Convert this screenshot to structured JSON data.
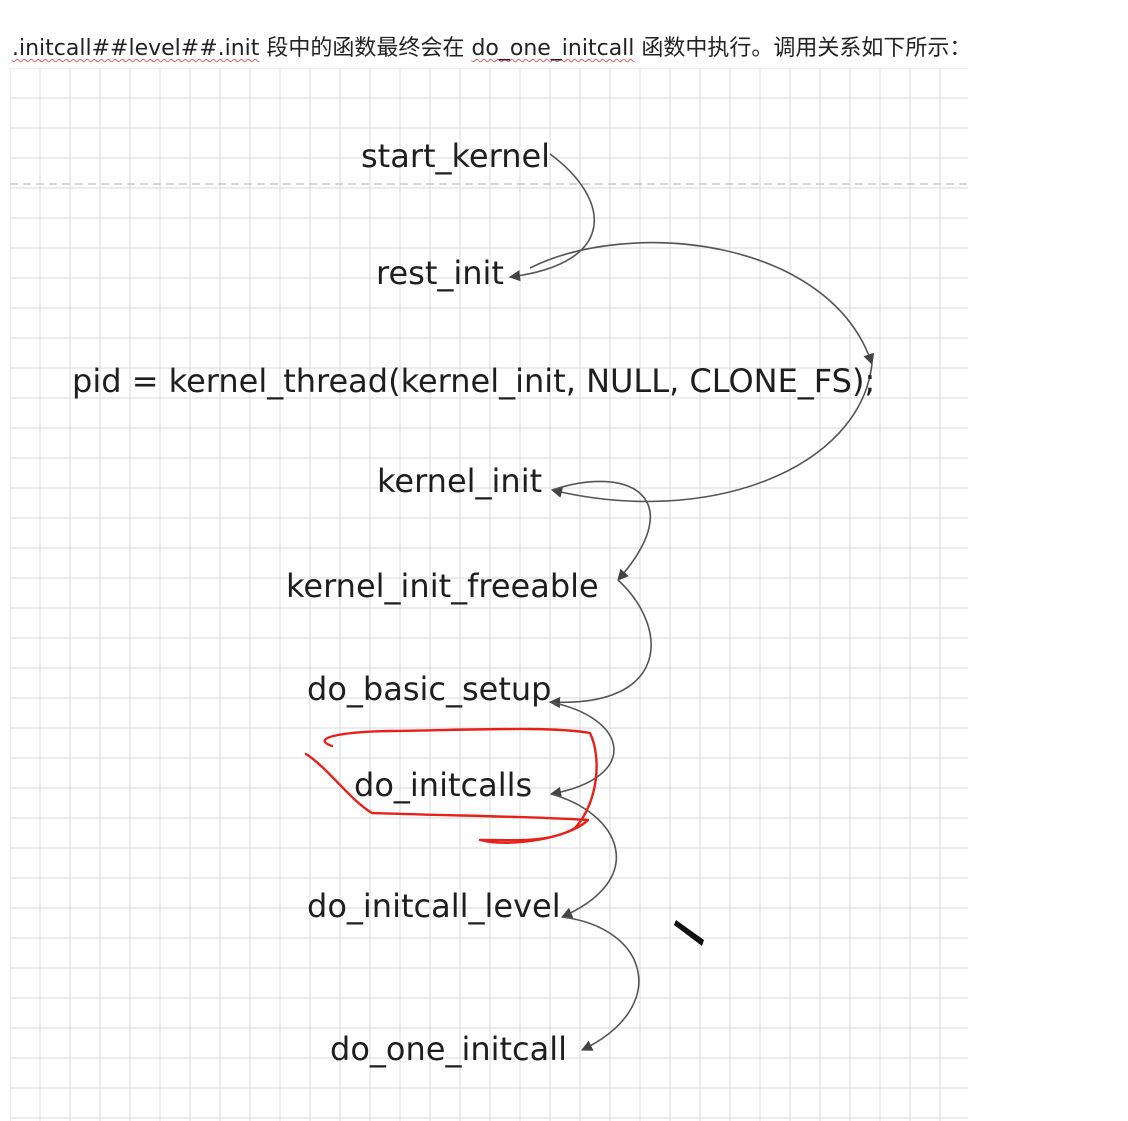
{
  "intro": {
    "prefix": ".initcall##level##.init",
    "middle": " 段中的函数最终会在 ",
    "func": "do_one_initcall",
    "suffix": " 函数中执行。调用关系如下所示："
  },
  "diagram": {
    "nodes": [
      {
        "id": "start_kernel",
        "label": "start_kernel"
      },
      {
        "id": "rest_init",
        "label": "rest_init"
      },
      {
        "id": "kernel_thread",
        "label": "pid = kernel_thread(kernel_init, NULL, CLONE_FS);"
      },
      {
        "id": "kernel_init",
        "label": "kernel_init"
      },
      {
        "id": "kernel_init_freeable",
        "label": "kernel_init_freeable"
      },
      {
        "id": "do_basic_setup",
        "label": "do_basic_setup"
      },
      {
        "id": "do_initcalls",
        "label": "do_initcalls"
      },
      {
        "id": "do_initcall_level",
        "label": "do_initcall_level"
      },
      {
        "id": "do_one_initcall",
        "label": "do_one_initcall"
      }
    ],
    "edges": [
      {
        "from": "start_kernel",
        "to": "rest_init"
      },
      {
        "from": "rest_init",
        "to": "kernel_thread"
      },
      {
        "from": "kernel_thread",
        "to": "kernel_init"
      },
      {
        "from": "kernel_init",
        "to": "kernel_init_freeable"
      },
      {
        "from": "kernel_init_freeable",
        "to": "do_basic_setup"
      },
      {
        "from": "do_basic_setup",
        "to": "do_initcalls"
      },
      {
        "from": "do_initcalls",
        "to": "do_initcall_level"
      },
      {
        "from": "do_initcall_level",
        "to": "do_one_initcall"
      }
    ],
    "highlighted_node": "do_initcalls",
    "colors": {
      "grid": "#d9d9d9",
      "arrow": "#555555",
      "highlight": "#e8201a",
      "text": "#1e1e1e"
    }
  }
}
